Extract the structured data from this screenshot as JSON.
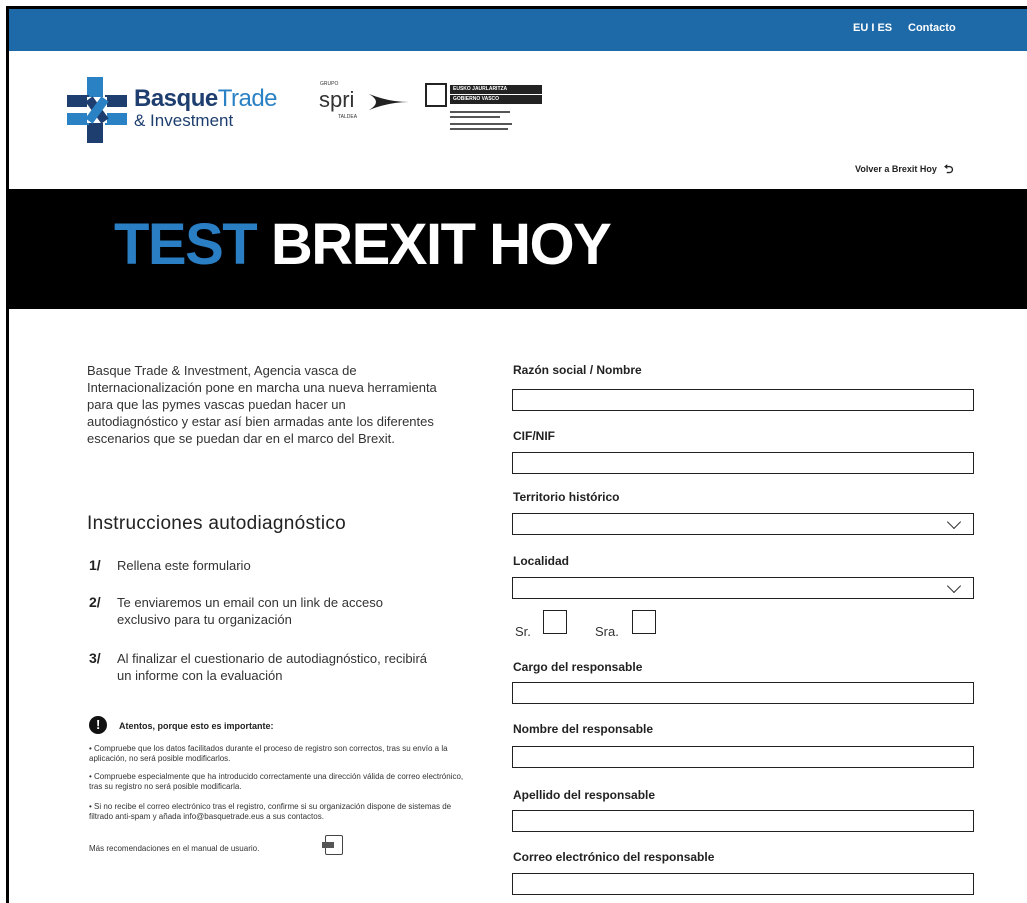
{
  "topbar": {
    "lang": "EU I ES",
    "contact": "Contacto"
  },
  "logos": {
    "bt_bold": "Basque",
    "bt_light": "Trade",
    "bt_sub": "& Investment",
    "spri_grupo": "GRUPO",
    "spri_name": "spri",
    "spri_taldea": "TALDEA",
    "gov_line1": "EUSKO JAURLARITZA",
    "gov_line2": "GOBIERNO VASCO"
  },
  "nav": {
    "back": "Volver a Brexit Hoy"
  },
  "hero": {
    "title_part1": "TEST",
    "title_part2": " BREXIT HOY"
  },
  "intro": "Basque Trade & Investment, Agencia vasca de Internacionalización pone en marcha una nueva herramienta para que las pymes vascas puedan hacer un autodiagnóstico y estar así bien armadas ante los diferentes escenarios que se puedan dar en el marco del Brexit.",
  "instructions": {
    "title": "Instrucciones autodiagnóstico",
    "steps": [
      {
        "num": "1/",
        "text": "Rellena este formulario"
      },
      {
        "num": "2/",
        "text": "Te enviaremos un email con un link de acceso exclusivo para tu organización"
      },
      {
        "num": "3/",
        "text": "Al finalizar el cuestionario de autodiagnóstico, recibirá un informe con la evaluación"
      }
    ]
  },
  "warning": {
    "title": "Atentos, porque esto es importante:",
    "notes": [
      "• Compruebe que los datos facilitados durante el proceso de registro son correctos, tras su envío a la aplicación, no será posible modificarlos.",
      "• Compruebe especialmente que ha introducido correctamente una dirección válida de correo electrónico, tras su registro no será posible modificarla.",
      "• Si no recibe el correo electrónico tras el registro, confirme si su organización dispone de sistemas de filtrado anti-spam y añada info@basquetrade.eus a sus contactos."
    ],
    "manual": "Más recomendaciones en el manual de usuario."
  },
  "form": {
    "razon_label": "Razón social / Nombre",
    "cif_label": "CIF/NIF",
    "territorio_label": "Territorio histórico",
    "localidad_label": "Localidad",
    "sr_label": "Sr.",
    "sra_label": "Sra.",
    "cargo_label": "Cargo del responsable",
    "nombre_label": "Nombre del responsable",
    "apellido_label": "Apellido del responsable",
    "correo_label": "Correo electrónico del responsable"
  }
}
